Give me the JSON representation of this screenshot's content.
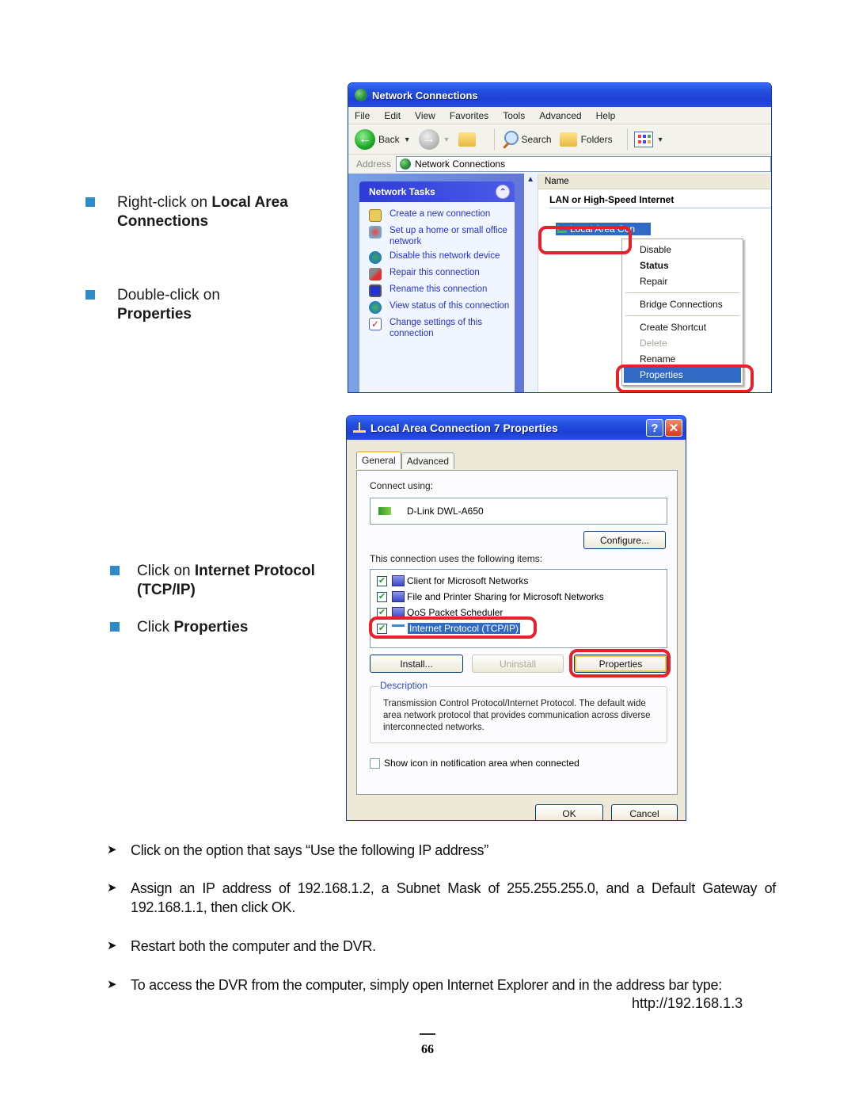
{
  "steps_upper": [
    {
      "prefix": "Right-click on ",
      "bold": "Local Area Connections"
    },
    {
      "prefix": "Double-click on ",
      "bold": "Properties"
    },
    {
      "prefix": "Click on ",
      "bold": "Internet Protocol (TCP/IP)"
    },
    {
      "prefix": "Click ",
      "bold": "Properties"
    }
  ],
  "network_window": {
    "title": "Network Connections",
    "menu": [
      "File",
      "Edit",
      "View",
      "Favorites",
      "Tools",
      "Advanced",
      "Help"
    ],
    "toolbar": {
      "back": "Back",
      "search": "Search",
      "folders": "Folders"
    },
    "address_label": "Address",
    "address_value": "Network Connections",
    "task_panel": {
      "title": "Network Tasks",
      "items": [
        "Create a new connection",
        "Set up a home or small office network",
        "Disable this network device",
        "Repair this connection",
        "Rename this connection",
        "View status of this connection",
        "Change settings of this connection"
      ]
    },
    "column_header": "Name",
    "group_header": "LAN or High-Speed Internet",
    "selected_item": "Local Area Con",
    "context_menu": {
      "items": [
        {
          "label": "Disable",
          "style": "normal"
        },
        {
          "label": "Status",
          "style": "bold"
        },
        {
          "label": "Repair",
          "style": "normal"
        },
        {
          "label": "Bridge Connections",
          "style": "normal"
        },
        {
          "label": "Create Shortcut",
          "style": "normal"
        },
        {
          "label": "Delete",
          "style": "disabled"
        },
        {
          "label": "Rename",
          "style": "normal"
        },
        {
          "label": "Properties",
          "style": "selected"
        }
      ]
    }
  },
  "properties_dialog": {
    "title": "Local Area Connection 7 Properties",
    "help_glyph": "?",
    "close_glyph": "✕",
    "tabs": [
      "General",
      "Advanced"
    ],
    "active_tab": "General",
    "connect_using_label": "Connect using:",
    "adapter": "D-Link DWL-A650",
    "configure_button": "Configure...",
    "items_label": "This connection uses the following items:",
    "items": [
      {
        "label": "Client for Microsoft Networks",
        "checked": true,
        "selected": false
      },
      {
        "label": "File and Printer Sharing for Microsoft Networks",
        "checked": true,
        "selected": false
      },
      {
        "label": "QoS Packet Scheduler",
        "checked": true,
        "selected": false
      },
      {
        "label": "Internet Protocol (TCP/IP)",
        "checked": true,
        "selected": true
      }
    ],
    "install_button": "Install...",
    "uninstall_button": "Uninstall",
    "properties_button": "Properties",
    "description_legend": "Description",
    "description_text": "Transmission Control Protocol/Internet Protocol. The default wide area network protocol that provides communication across diverse interconnected networks.",
    "show_icon_label": "Show icon in notification area when connected",
    "show_icon_checked": false,
    "ok_button": "OK",
    "cancel_button": "Cancel"
  },
  "steps_lower": [
    "Click on the option that says “Use the following IP address”",
    "Assign an IP address of 192.168.1.2, a Subnet Mask of 255.255.255.0, and a Default Gateway of 192.168.1.1, then click OK.",
    "Restart both the computer and the DVR.",
    "To access the DVR from the computer, simply open Internet Explorer and in the address bar type:"
  ],
  "access_url": "http://192.168.1.3",
  "page_number": "66",
  "colors": {
    "bullet_square": "#2e8bc9",
    "highlight_ring": "#e8202a",
    "xp_title_blue": "#2451e0",
    "selection_blue": "#316ac5"
  }
}
